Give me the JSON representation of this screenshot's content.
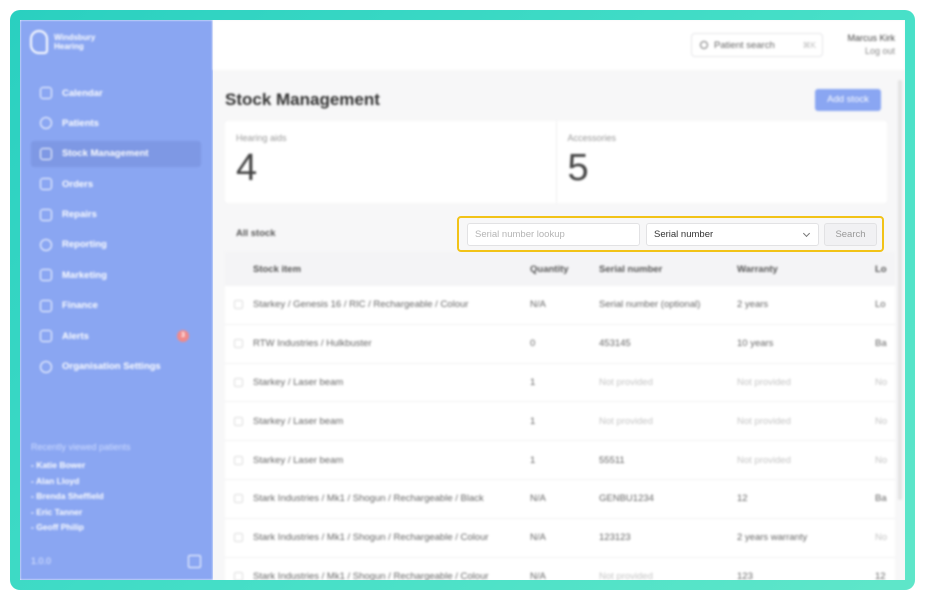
{
  "brand": {
    "name_line1": "Windsbury",
    "name_line2": "Hearing"
  },
  "sidebar": {
    "items": [
      {
        "label": "Calendar",
        "name": "calendar"
      },
      {
        "label": "Patients",
        "name": "patients"
      },
      {
        "label": "Stock Management",
        "name": "stock-management",
        "active": true
      },
      {
        "label": "Orders",
        "name": "orders"
      },
      {
        "label": "Repairs",
        "name": "repairs"
      },
      {
        "label": "Reporting",
        "name": "reporting"
      },
      {
        "label": "Marketing",
        "name": "marketing"
      },
      {
        "label": "Finance",
        "name": "finance"
      },
      {
        "label": "Alerts",
        "name": "alerts",
        "badge": "3"
      },
      {
        "label": "Organisation Settings",
        "name": "organisation-settings"
      }
    ],
    "recent_title": "Recently viewed patients",
    "recent": [
      "- Katie Bower",
      "- Alan Lloyd",
      "- Brenda Sheffield",
      "- Eric Tanner",
      "- Geoff Philip"
    ],
    "version": "1.0.0"
  },
  "topbar": {
    "search_label": "Patient search",
    "search_shortcut": "⌘K",
    "user_name": "Marcus Kirk",
    "logout": "Log out"
  },
  "page": {
    "title": "Stock Management",
    "add_button": "Add stock",
    "stats": [
      {
        "label": "Hearing aids",
        "value": "4"
      },
      {
        "label": "Accessories",
        "value": "5"
      }
    ],
    "section_label": "All stock"
  },
  "lookup": {
    "placeholder": "Serial number lookup",
    "select_value": "Serial number",
    "button": "Search"
  },
  "table": {
    "headers": [
      "Stock item",
      "Quantity",
      "Serial number",
      "Warranty",
      "Lo"
    ],
    "rows": [
      [
        "Starkey / Genesis 16 / RIC / Rechargeable / Colour",
        "N/A",
        "Serial number (optional)",
        "2 years",
        "Lo"
      ],
      [
        "RTW Industries / Hulkbuster",
        "0",
        "453145",
        "10 years",
        "Ba"
      ],
      [
        "Starkey / Laser beam",
        "1",
        "Not provided",
        "Not provided",
        "No"
      ],
      [
        "Starkey / Laser beam",
        "1",
        "Not provided",
        "Not provided",
        "No"
      ],
      [
        "Starkey / Laser beam",
        "1",
        "55511",
        "Not provided",
        "No"
      ],
      [
        "Stark Industries / Mk1 / Shogun / Rechargeable / Black",
        "N/A",
        "GENBU1234",
        "12",
        "Ba"
      ],
      [
        "Stark Industries / Mk1 / Shogun / Rechargeable / Colour",
        "N/A",
        "123123",
        "2 years warranty",
        "No"
      ],
      [
        "Stark Industries / Mk1 / Shogun / Rechargeable / Colour",
        "N/A",
        "Not provided",
        "123",
        "12"
      ]
    ]
  },
  "colors": {
    "accent": "#8aa6f2",
    "highlight": "#f2c318",
    "frame": "#3ad8c4"
  }
}
